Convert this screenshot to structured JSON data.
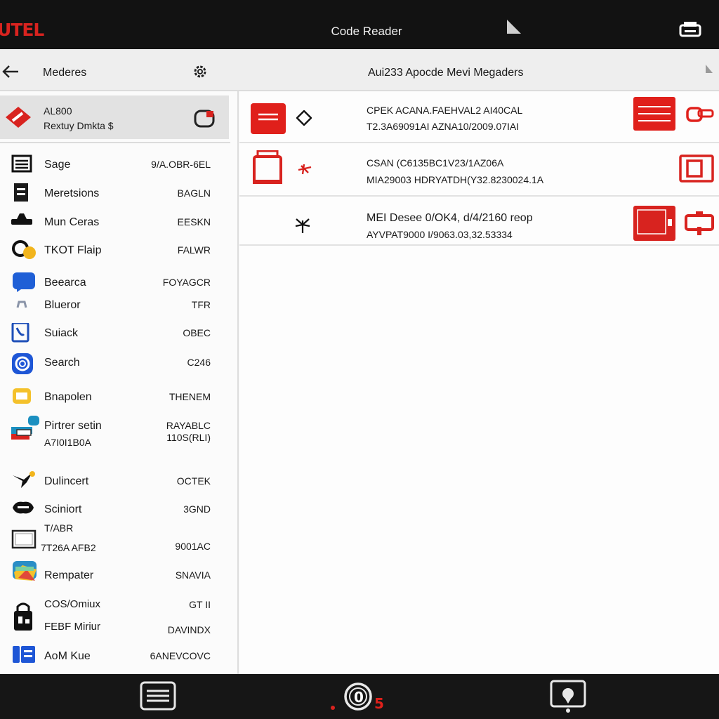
{
  "header": {
    "brand": "UTEL",
    "title": "Code Reader"
  },
  "subheader": {
    "left_title": "Mederes",
    "right_title": "Aui233 Apocde Mevi Megaders"
  },
  "vehicle": {
    "line1": "AL800",
    "line2": "Rextuy Dmkta $"
  },
  "menu": [
    {
      "icon": "list-icon",
      "label": "Sage",
      "value": "9/A.OBR-6EL"
    },
    {
      "icon": "module-icon",
      "label": "Meretsions",
      "value": "BAGLN"
    },
    {
      "icon": "car-icon",
      "label": "Mun Ceras",
      "value": "EESKN"
    },
    {
      "icon": "gauge-icon",
      "label": "TKOT Flaip",
      "value": "FALWR"
    },
    {
      "icon": "chat-icon",
      "label": "Beearca",
      "value": "FOYAGCR"
    },
    {
      "icon": "car-small-icon",
      "label": "Blueror",
      "value": "TFR"
    },
    {
      "icon": "phone-icon",
      "label": "Suiack",
      "value": "OBEC"
    },
    {
      "icon": "search-icon",
      "label": "Search",
      "value": "C246"
    },
    {
      "icon": "folder-icon",
      "label": "Bnapolen",
      "value": "THENEM"
    },
    {
      "icon": "printer-icon",
      "label": "Pirtrer setin",
      "label2": "A7I0I1B0A",
      "value": "RAYABLC",
      "value2": "110S(RLI)"
    },
    {
      "icon": "plane-icon",
      "label": "Dulincert",
      "value": "OCTEK"
    },
    {
      "icon": "support-icon",
      "label": "Sciniort",
      "value": "3GND"
    },
    {
      "icon": "screen-icon",
      "label": "T/ABR",
      "label2": "7T26A AFB2",
      "value": "9001AC"
    },
    {
      "icon": "map-icon",
      "label": "Rempater",
      "value": "SNAVIA"
    },
    {
      "icon": "lock-icon",
      "label": "COS/Omiux",
      "label2": "FEBF Miriur",
      "value": "GT II",
      "value2": "DAVINDX"
    },
    {
      "icon": "doc-icon",
      "label": "AoM Kue",
      "value": "6ANEVCOVC"
    }
  ],
  "codes": [
    {
      "line1": "CPEK ACANA.FAEHVAL2 AI40CAL",
      "line2": "T2.3A69091AI AZNA10/2009.07IAI"
    },
    {
      "line1": "CSAN (C6135BC1V23/1AZ06A",
      "line2": "MIA29003 HDRYATDH(Y32.8230024.1A"
    },
    {
      "line1": "MEI Desee 0/OK4, d/4/2160 reop",
      "line2": "AYVPAT9000 I/9063.03,32.53334"
    }
  ],
  "bottombar": {
    "badge": "5"
  },
  "colors": {
    "accent": "#d8231f",
    "topbar": "#121212",
    "bottombar": "#161616",
    "panel": "#fbfbfb"
  }
}
